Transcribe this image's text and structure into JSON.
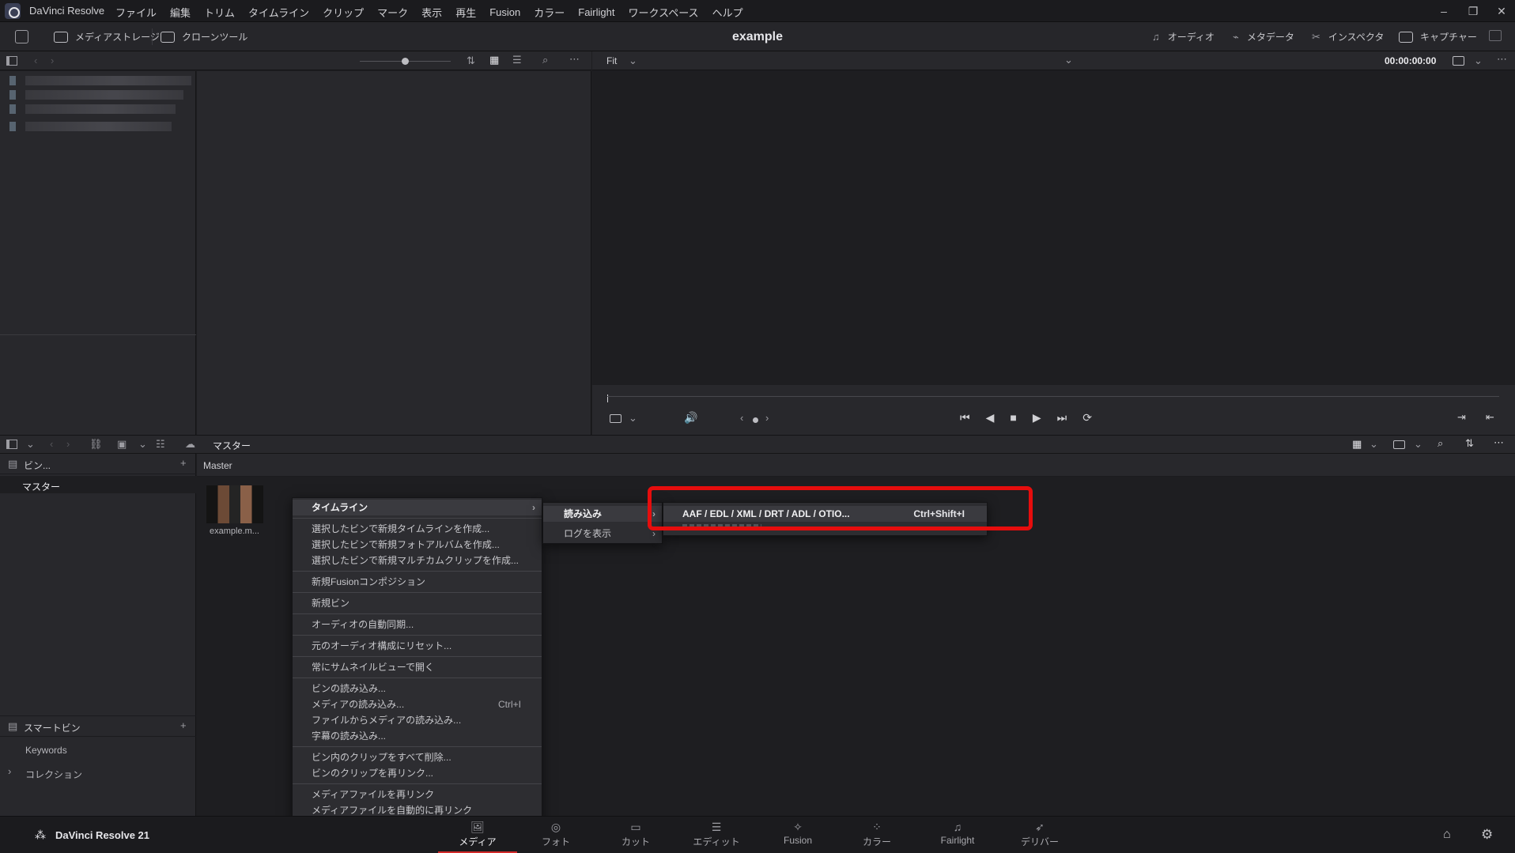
{
  "titlebar": {
    "app_name": "DaVinci Resolve",
    "menus": [
      "ファイル",
      "編集",
      "トリム",
      "タイムライン",
      "クリップ",
      "マーク",
      "表示",
      "再生",
      "Fusion",
      "カラー",
      "Fairlight",
      "ワークスペース",
      "ヘルプ"
    ],
    "minimize": "–",
    "restore": "❐",
    "close": "✕"
  },
  "toolbar": {
    "media_storage": "メディアストレージ",
    "clone_tool": "クローンツール",
    "project_title": "example",
    "audio": "オーディオ",
    "metadata": "メタデータ",
    "inspector": "インスペクタ",
    "capture": "キャプチャー"
  },
  "viewer": {
    "fit": "Fit",
    "timecode": "00:00:00:00"
  },
  "bin_bar": {
    "path": "マスター"
  },
  "bins": {
    "header": "ビン...",
    "master": "マスター",
    "smart_bins": "スマートビン",
    "keywords": "Keywords",
    "collections": "コレクション"
  },
  "bin_content": {
    "header": "Master",
    "clip_name": "example.m..."
  },
  "context_menu": {
    "items": [
      {
        "label": "タイムライン",
        "submenu": true,
        "highlight": true
      },
      {
        "sep": true
      },
      {
        "label": "選択したビンで新規タイムラインを作成..."
      },
      {
        "label": "選択したビンで新規フォトアルバムを作成..."
      },
      {
        "label": "選択したビンで新規マルチカムクリップを作成..."
      },
      {
        "sep": true
      },
      {
        "label": "新規Fusionコンポジション"
      },
      {
        "sep": true
      },
      {
        "label": "新規ビン"
      },
      {
        "sep": true
      },
      {
        "label": "オーディオの自動同期..."
      },
      {
        "sep": true
      },
      {
        "label": "元のオーディオ構成にリセット..."
      },
      {
        "sep": true
      },
      {
        "label": "常にサムネイルビューで開く"
      },
      {
        "sep": true
      },
      {
        "label": "ビンの読み込み..."
      },
      {
        "label": "メディアの読み込み...",
        "shortcut": "Ctrl+I"
      },
      {
        "label": "ファイルからメディアの読み込み..."
      },
      {
        "label": "字幕の読み込み..."
      },
      {
        "sep": true
      },
      {
        "label": "ビン内のクリップをすべて削除..."
      },
      {
        "label": "ビンのクリップを再リンク..."
      },
      {
        "sep": true
      },
      {
        "label": "メディアファイルを再リンク"
      },
      {
        "label": "メディアファイルを自動的に再リンク"
      }
    ]
  },
  "submenu_1": {
    "import": "読み込み",
    "show_log": "ログを表示"
  },
  "submenu_2": {
    "import_aaf": "AAF / EDL / XML / DRT / ADL / OTIO...",
    "shortcut": "Ctrl+Shift+I"
  },
  "pagebar": {
    "brand": "DaVinci Resolve 21",
    "tabs": [
      {
        "label": "メディア",
        "icon": "🖼",
        "active": true
      },
      {
        "label": "フォト",
        "icon": "◎"
      },
      {
        "label": "カット",
        "icon": "▭"
      },
      {
        "label": "エディット",
        "icon": "☰"
      },
      {
        "label": "Fusion",
        "icon": "✧"
      },
      {
        "label": "カラー",
        "icon": "⁘"
      },
      {
        "label": "Fairlight",
        "icon": "♫"
      },
      {
        "label": "デリバー",
        "icon": "➶"
      }
    ]
  },
  "colors": {
    "accent_red": "#e60d0d",
    "active_tab": "#d32a2a"
  }
}
